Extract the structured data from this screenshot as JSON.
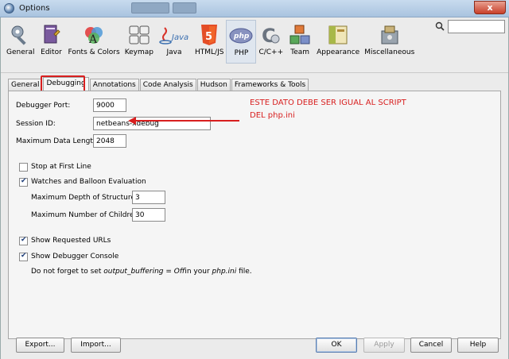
{
  "window": {
    "title": "Options",
    "close_label": "x"
  },
  "categories": [
    {
      "label": "General",
      "icon": "general-icon"
    },
    {
      "label": "Editor",
      "icon": "editor-icon"
    },
    {
      "label": "Fonts & Colors",
      "icon": "fonts-colors-icon"
    },
    {
      "label": "Keymap",
      "icon": "keymap-icon"
    },
    {
      "label": "Java",
      "icon": "java-icon"
    },
    {
      "label": "HTML/JS",
      "icon": "html5-icon"
    },
    {
      "label": "PHP",
      "icon": "php-icon",
      "selected": true
    },
    {
      "label": "C/C++",
      "icon": "cpp-icon"
    },
    {
      "label": "Team",
      "icon": "team-icon"
    },
    {
      "label": "Appearance",
      "icon": "appearance-icon"
    },
    {
      "label": "Miscellaneous",
      "icon": "miscellaneous-icon"
    }
  ],
  "search": {
    "value": "",
    "placeholder": ""
  },
  "tabs": [
    {
      "label": "General"
    },
    {
      "label": "Debugging",
      "active": true
    },
    {
      "label": "Annotations"
    },
    {
      "label": "Code Analysis"
    },
    {
      "label": "Hudson"
    },
    {
      "label": "Frameworks & Tools"
    }
  ],
  "debugging": {
    "port_label": "Debugger Port:",
    "port_value": "9000",
    "session_label": "Session ID:",
    "session_value": "netbeans-xdebug",
    "max_length_label": "Maximum Data Length:",
    "max_length_value": "2048",
    "stop_first_line_label": "Stop at First Line",
    "stop_first_line_checked": false,
    "watches_label": "Watches and Balloon Evaluation",
    "watches_checked": true,
    "max_depth_label": "Maximum Depth of Structures:",
    "max_depth_value": "3",
    "max_children_label": "Maximum Number of Children:",
    "max_children_value": "30",
    "show_urls_label": "Show Requested URLs",
    "show_urls_checked": true,
    "show_console_label": "Show Debugger Console",
    "show_console_checked": true,
    "note_prefix": "Do not forget to set ",
    "note_setting": "output_buffering = Off",
    "note_middle": "in your ",
    "note_file": "php.ini",
    "note_suffix": " file."
  },
  "annotation": {
    "line1": "ESTE DATO DEBE SER IGUAL AL SCRIPT",
    "line2": "DEL php.ini",
    "color": "#d81f1f"
  },
  "buttons": {
    "export": "Export...",
    "import": "Import...",
    "ok": "OK",
    "apply": "Apply",
    "cancel": "Cancel",
    "help": "Help"
  },
  "colors": {
    "highlight": "#d81f1f",
    "selected_category_bg": "#dfe6ef"
  }
}
